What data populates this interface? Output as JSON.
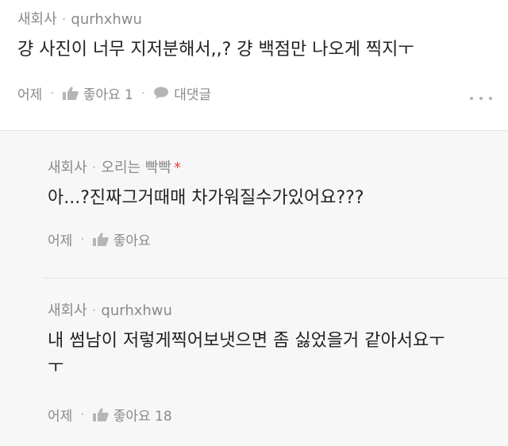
{
  "comment": {
    "company": "새회사",
    "nickname": "qurhxhwu",
    "text": "걍 사진이 너무 지저분해서,,? 걍 백점만 나오게 찍지ㅜ",
    "time": "어제",
    "like_label": "좋아요 1",
    "reply_label": "대댓글"
  },
  "replies": [
    {
      "company": "새회사",
      "nickname": "오리는 빡빡",
      "badge": "*",
      "text": "아...?진짜그거때매 차가워질수가있어요???",
      "time": "어제",
      "like_label": "좋아요"
    },
    {
      "company": "새회사",
      "nickname": "qurhxhwu",
      "text_line1": "내 썸남이 저렇게찍어보냇으면 좀 싫었을거 같아서요ㅜ",
      "text_line2": "ㅜ",
      "time": "어제",
      "like_label": "좋아요 18"
    }
  ],
  "icons": {
    "like": "thumbs-up-icon",
    "reply": "speech-bubble-icon",
    "more": "more-dots-icon"
  },
  "colors": {
    "reply_background": "#f7f7f7",
    "badge": "#e8453c"
  }
}
